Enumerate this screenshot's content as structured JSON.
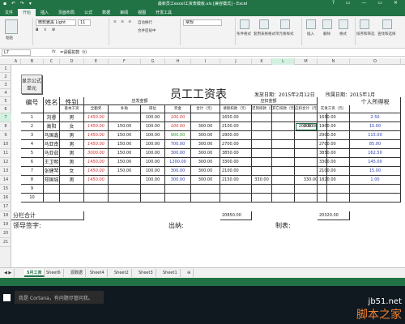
{
  "window": {
    "title": "最新员工excel工资表模板.xls [兼容模式] - Excel",
    "controls": [
      "?",
      "□",
      "—",
      "□",
      "✕"
    ]
  },
  "ribbon": {
    "tabs": [
      "文件",
      "开始",
      "插入",
      "页面布局",
      "公式",
      "数据",
      "审阅",
      "视图",
      "开发工具"
    ],
    "active_tab": "开始",
    "font_name": "微软雅黑 Light",
    "font_size": "11",
    "number_format": "常规",
    "labels": {
      "paste": "粘贴",
      "wrap": "自动换行",
      "merge": "合并后居中",
      "cond_format": "条件格式",
      "table_format": "套用表格格式",
      "cell_style": "单元格样式",
      "insert": "插入",
      "delete": "删除",
      "format": "格式",
      "sort": "排序和筛选",
      "find": "查找和选择"
    }
  },
  "formula_bar": {
    "name_box": "L7",
    "fx": "fx",
    "formula": "=请假扣款（t）"
  },
  "columns": [
    "A",
    "B",
    "C",
    "D",
    "E",
    "F",
    "G",
    "H",
    "I",
    "J",
    "K",
    "L",
    "M",
    "N",
    "O"
  ],
  "selected_column": "L",
  "rows": [
    "1",
    "2",
    "3",
    "4",
    "5",
    "6",
    "7",
    "8",
    "9",
    "10",
    "11",
    "12",
    "13",
    "14",
    "15",
    "16",
    "17",
    "18",
    "19",
    "20",
    "21"
  ],
  "selected_row": "7",
  "sheet": {
    "macro_button": "显示公式单元",
    "title": "员工工资表",
    "issue_date": "发放日期：2015年2月12日",
    "month": "所属日期：2015年1月",
    "group_payable": "应发金额",
    "group_deduct": "应扣金额",
    "headers": {
      "no": "编号",
      "name": "姓名",
      "gender": "性别",
      "base": "基本工资",
      "allowance": "全勤奖",
      "subsidy": "补助",
      "post": "岗位",
      "bonus": "奖金",
      "total": "合计（元）",
      "leave": "请假扣款（元）",
      "late": "迟到扣款（元）",
      "other": "其它扣款（元）",
      "deduct_total": "应扣合计（元）",
      "actual": "实发工资（元）",
      "tax": "个人所得税"
    },
    "employees": [
      {
        "no": "1",
        "name": "刘睿",
        "gender": "男",
        "base": "1450.00",
        "allowance": "",
        "subsidy": "100.00",
        "post": "100.00",
        "bonus": "",
        "total": "1650.00",
        "leave": "",
        "late": "",
        "other": "",
        "deduct_total": "",
        "actual": "1650.00",
        "tax": "2.50"
      },
      {
        "no": "2",
        "name": "高阳",
        "gender": "女",
        "base": "1450.00",
        "allowance": "150.00",
        "subsidy": "100.00",
        "post": "100.00",
        "bonus": "300.00",
        "total": "2100.00",
        "leave": "",
        "late": "",
        "other": "200.00",
        "deduct_total": "200.00",
        "actual": "1900.00",
        "tax": "15.00"
      },
      {
        "no": "3",
        "name": "马国鑫",
        "gender": "男",
        "base": "1450.00",
        "allowance": "150.00",
        "subsidy": "100.00",
        "post": "900.00",
        "bonus": "300.00",
        "total": "2900.00",
        "leave": "",
        "late": "",
        "other": "",
        "deduct_total": "",
        "actual": "2900.00",
        "tax": "115.00"
      },
      {
        "no": "4",
        "name": "马亚南",
        "gender": "男",
        "base": "1450.00",
        "allowance": "150.00",
        "subsidy": "100.00",
        "post": "700.00",
        "bonus": "300.00",
        "total": "2700.00",
        "leave": "",
        "late": "",
        "other": "",
        "deduct_total": "",
        "actual": "2700.00",
        "tax": "85.00"
      },
      {
        "no": "5",
        "name": "马亚茹",
        "gender": "男",
        "base": "3000.00",
        "allowance": "150.00",
        "subsidy": "100.00",
        "post": "300.00",
        "bonus": "300.00",
        "total": "3850.00",
        "leave": "",
        "late": "",
        "other": "",
        "deduct_total": "",
        "actual": "3850.00",
        "tax": "162.50"
      },
      {
        "no": "6",
        "name": "王卫明",
        "gender": "男",
        "base": "1450.00",
        "allowance": "150.00",
        "subsidy": "100.00",
        "post": "1200.00",
        "bonus": "300.00",
        "total": "3300.00",
        "leave": "",
        "late": "",
        "other": "",
        "deduct_total": "",
        "actual": "3300.00",
        "tax": "145.00"
      },
      {
        "no": "7",
        "name": "张健琴",
        "gender": "女",
        "base": "1450.00",
        "allowance": "150.00",
        "subsidy": "100.00",
        "post": "300.00",
        "bonus": "300.00",
        "total": "2100.00",
        "leave": "",
        "late": "",
        "other": "",
        "deduct_total": "",
        "actual": "2100.00",
        "tax": "15.00"
      },
      {
        "no": "8",
        "name": "郑国城",
        "gender": "男",
        "base": "1450.00",
        "allowance": "",
        "subsidy": "100.00",
        "post": "300.00",
        "bonus": "300.00",
        "total": "2150.00",
        "leave": "330.00",
        "late": "",
        "other": "",
        "deduct_total": "330.00",
        "actual": "1820.00",
        "tax": "1.00"
      },
      {
        "no": "9",
        "name": "",
        "gender": "",
        "base": "",
        "allowance": "",
        "subsidy": "",
        "post": "",
        "bonus": "",
        "total": "",
        "leave": "",
        "late": "",
        "other": "",
        "deduct_total": "",
        "actual": "",
        "tax": ""
      },
      {
        "no": "10",
        "name": "",
        "gender": "",
        "base": "",
        "allowance": "",
        "subsidy": "",
        "post": "",
        "bonus": "",
        "total": "",
        "leave": "",
        "late": "",
        "other": "",
        "deduct_total": "",
        "actual": "",
        "tax": ""
      }
    ],
    "subtotal_label": "分栏合计",
    "subtotal_total": "20850.00",
    "subtotal_actual": "20320.00",
    "sign_leader": "领导签字:",
    "sign_cashier": "出纳:",
    "sign_preparer": "制表:"
  },
  "sheet_tabs": [
    "5月工资",
    "Sheet6",
    "源数据",
    "Sheet4",
    "Sheet2",
    "Sheet3",
    "Sheet1"
  ],
  "active_sheet": "5月工资",
  "taskbar": {
    "search_placeholder": "我是 Cortana，有问题尽管问我。"
  },
  "watermark": {
    "site": "jb51.net",
    "name": "脚本之家"
  }
}
